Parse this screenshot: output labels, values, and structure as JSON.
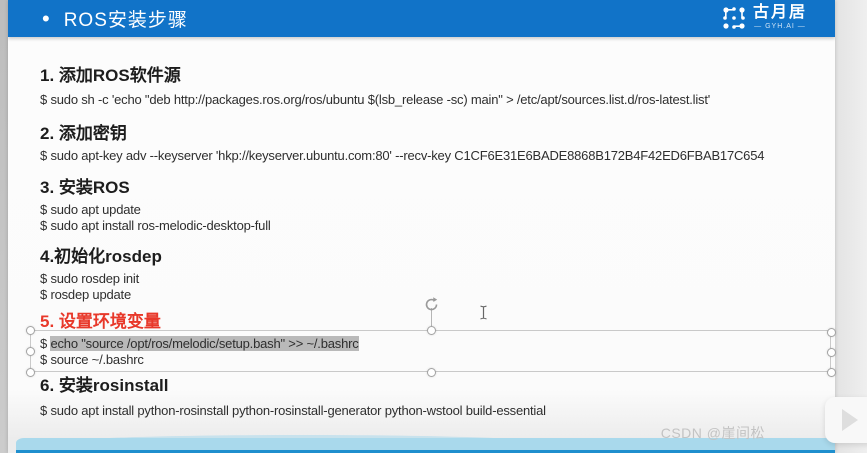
{
  "header": {
    "bullet": "•",
    "title": "ROS安装步骤",
    "logo_name": "古月居",
    "logo_sub": "— GYH.AI —"
  },
  "steps": [
    {
      "heading": "1. 添加ROS软件源",
      "lines": [
        {
          "prefix": "$ ",
          "text": "sudo sh -c 'echo \"deb http://packages.ros.org/ros/ubuntu $(lsb_release -sc) main\" > /etc/apt/sources.list.d/ros-latest.list'"
        }
      ]
    },
    {
      "heading": "2. 添加密钥",
      "lines": [
        {
          "prefix": "$ ",
          "text": "sudo apt-key adv --keyserver 'hkp://keyserver.ubuntu.com:80' --recv-key C1CF6E31E6BADE8868B172B4F42ED6FBAB17C654"
        }
      ]
    },
    {
      "heading": "3. 安装ROS",
      "lines": [
        {
          "prefix": "$ ",
          "text": "sudo apt update"
        },
        {
          "prefix": "$ ",
          "text": "sudo apt install ros-melodic-desktop-full"
        }
      ]
    },
    {
      "heading": "4.初始化rosdep",
      "lines": [
        {
          "prefix": "$ ",
          "text": "sudo rosdep init"
        },
        {
          "prefix": "$ ",
          "text": "rosdep update"
        }
      ]
    },
    {
      "heading": "5. 设置环境变量",
      "lines": [
        {
          "prefix": "$ ",
          "text": "echo \"source /opt/ros/melodic/setup.bash\" >> ~/.bashrc",
          "highlighted": true
        },
        {
          "prefix": "$ ",
          "text": "source ~/.bashrc"
        }
      ]
    },
    {
      "heading": "6. 安装rosinstall",
      "lines": [
        {
          "prefix": "$ ",
          "text": "sudo apt install python-rosinstall python-rosinstall-generator python-wstool build-essential"
        }
      ]
    }
  ],
  "watermark": "CSDN @崖间松",
  "colors": {
    "header_blue": "#1173c8",
    "step5_red": "#e8382a",
    "highlight_gray": "#b9b9b9",
    "band_blue": "#a9d9ec",
    "band_line": "#1f8fce"
  }
}
